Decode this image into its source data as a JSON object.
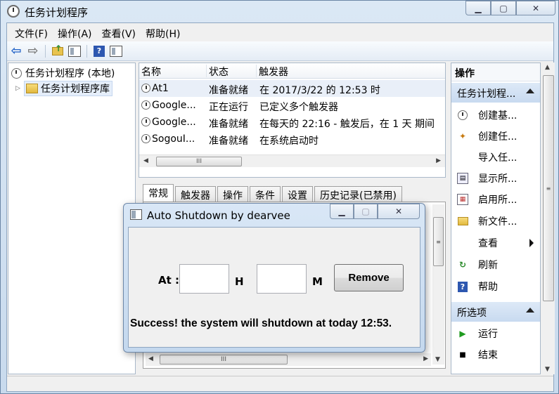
{
  "window": {
    "title": "任务计划程序"
  },
  "menubar": {
    "items": [
      "文件(F)",
      "操作(A)",
      "查看(V)",
      "帮助(H)"
    ]
  },
  "tree": {
    "root": "任务计划程序 (本地)",
    "library": "任务计划程序库"
  },
  "task_list": {
    "columns": [
      "名称",
      "状态",
      "触发器"
    ],
    "rows": [
      {
        "name": "At1",
        "status": "准备就绪",
        "trigger": "在 2017/3/22 的 12:53 时"
      },
      {
        "name": "Google...",
        "status": "正在运行",
        "trigger": "已定义多个触发器"
      },
      {
        "name": "Google...",
        "status": "准备就绪",
        "trigger": "在每天的 22:16 - 触发后，在 1 天 期间"
      },
      {
        "name": "SogouI...",
        "status": "准备就绪",
        "trigger": "在系统启动时"
      }
    ]
  },
  "detail_tabs": [
    "常规",
    "触发器",
    "操作",
    "条件",
    "设置",
    "历史记录(已禁用)"
  ],
  "actions": {
    "title": "操作",
    "group1": "任务计划程...",
    "items": [
      {
        "label": "创建基...",
        "icon": "create-basic-task-icon"
      },
      {
        "label": "创建任...",
        "icon": "create-task-icon"
      },
      {
        "label": "导入任...",
        "icon": ""
      },
      {
        "label": "显示所...",
        "icon": "display-running-tasks-icon"
      },
      {
        "label": "启用所...",
        "icon": "enable-history-icon"
      },
      {
        "label": "新文件...",
        "icon": "new-folder-icon"
      },
      {
        "label": "查看",
        "icon": ""
      },
      {
        "label": "刷新",
        "icon": "refresh-icon"
      },
      {
        "label": "帮助",
        "icon": "help-icon"
      }
    ],
    "group2": "所选项",
    "items2": [
      {
        "label": "运行",
        "icon": "run-icon"
      },
      {
        "label": "结束",
        "icon": "end-icon"
      }
    ]
  },
  "dialog": {
    "title": "Auto Shutdown by dearvee",
    "at_label": "At :",
    "hour_value": "",
    "h_label": "H",
    "minute_value": "",
    "m_label": "M",
    "remove_label": "Remove",
    "status_message": "Success! the system will shutdown at today 12:53."
  },
  "colors": {
    "accent": "#2463c7",
    "selection": "#e9eff8",
    "group_header": "#c8daf0"
  }
}
